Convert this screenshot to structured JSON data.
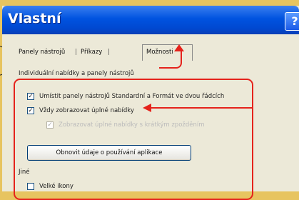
{
  "dialog": {
    "title": "Vlastní",
    "help_label": "?"
  },
  "tabs": [
    {
      "label": "Panely nástrojů"
    },
    {
      "label": "Příkazy"
    },
    {
      "label": "Možnosti"
    }
  ],
  "section_personal": "Individuální nabídky a panely nástrojů",
  "options": [
    {
      "label": "Umístit panely nástrojů Standardní a Formát ve dvou řádcích",
      "checked": true,
      "enabled": true
    },
    {
      "label": "Vždy zobrazovat úplné nabídky",
      "checked": true,
      "enabled": true
    },
    {
      "label": "Zobrazovat úplné nabídky s krátkým zpožděním",
      "checked": true,
      "enabled": false
    }
  ],
  "reset_button": "Obnovit údaje o používání aplikace",
  "section_other": "Jiné",
  "other_options": [
    {
      "label": "Velké ikony",
      "checked": false
    }
  ],
  "colors": {
    "annotation": "#e5231c",
    "titlebar": "#0053e0",
    "background": "#e7c460"
  }
}
